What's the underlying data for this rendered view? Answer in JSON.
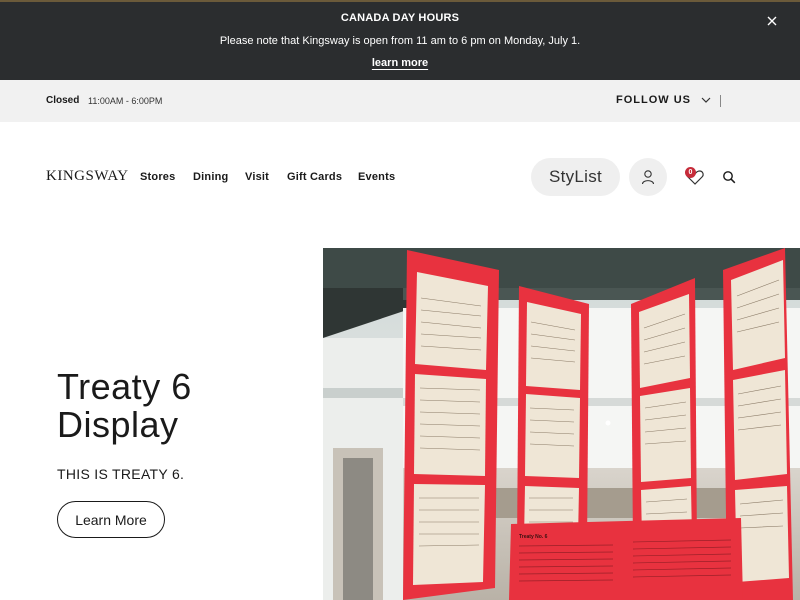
{
  "banner": {
    "title": "CANADA DAY HOURS",
    "text": "Please note that Kingsway is open from 11 am to 6 pm on Monday, July 1.",
    "link": "learn more"
  },
  "hours_bar": {
    "status": "Closed",
    "time": "11:00AM - 6:00PM",
    "follow_label": "FOLLOW US"
  },
  "nav": {
    "logo": "KINGSWAY",
    "items": [
      "Stores",
      "Dining",
      "Visit",
      "Gift Cards",
      "Events"
    ],
    "stylist_label": "StyList",
    "wishlist_count": "0"
  },
  "hero": {
    "title": "Treaty 6 Display",
    "subtitle": "THIS IS TREATY 6.",
    "button_label": "Learn More",
    "image_sign_title": "Treaty No. 6"
  },
  "icons": {
    "close": "close-icon",
    "chevron": "chevron-down-icon",
    "account": "user-icon",
    "wishlist": "heart-icon",
    "search": "search-icon"
  },
  "colors": {
    "banner_bg": "#2b2d2f",
    "hours_bg": "#f1f1f1",
    "badge": "#c62c3a",
    "treaty_red": "#e8323f"
  }
}
